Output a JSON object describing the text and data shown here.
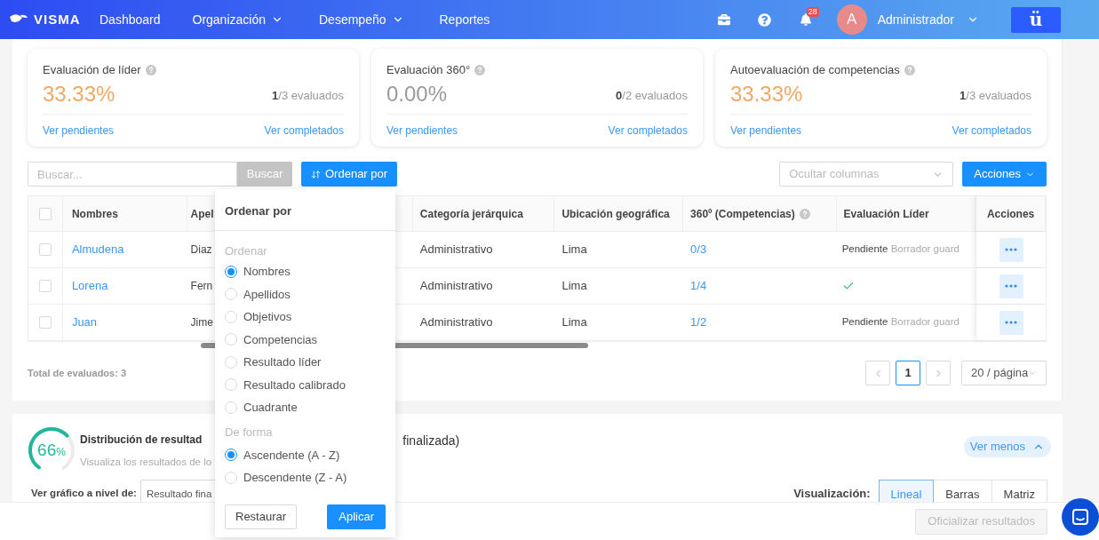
{
  "nav": {
    "logo": "VISMA",
    "items": [
      {
        "label": "Dashboard",
        "dropdown": false
      },
      {
        "label": "Organización",
        "dropdown": true
      },
      {
        "label": "Desempeño",
        "dropdown": true
      },
      {
        "label": "Reportes",
        "dropdown": false
      }
    ],
    "notifications": "28",
    "avatar": "A",
    "user": "Administrador",
    "app_button": "ü"
  },
  "cards": [
    {
      "title": "Evaluación de líder",
      "percent": "33.33%",
      "color": "#f2a863",
      "done": "1",
      "total": "/3 evaluados",
      "link_pending": "Ver pendientes",
      "link_done": "Ver completados"
    },
    {
      "title": "Evaluación 360°",
      "percent": "0.00%",
      "color": "#9b9b9b",
      "done": "0",
      "total": "/2 evaluados",
      "link_pending": "Ver pendientes",
      "link_done": "Ver completados"
    },
    {
      "title": "Autoevaluación de competencias",
      "percent": "33.33%",
      "color": "#f2a863",
      "done": "1",
      "total": "/3 evaluados",
      "link_pending": "Ver pendientes",
      "link_done": "Ver completados"
    }
  ],
  "toolbar": {
    "search": {
      "placeholder": "Buscar..."
    },
    "search_button": "Buscar",
    "sort_button": "Ordenar por",
    "hide_columns": {
      "placeholder": "Ocultar columnas"
    },
    "actions_button": "Acciones"
  },
  "table": {
    "select_all": {
      "checked": false
    },
    "columns": [
      {
        "label": "Nombres",
        "help": false
      },
      {
        "label": "Apel",
        "help": false
      },
      {
        "label": "Categoría jerárquica",
        "help": false
      },
      {
        "label": "Ubicación geográfica",
        "help": false
      },
      {
        "label": "360º (Competencias)",
        "help": true
      },
      {
        "label": "Evaluación Líder",
        "help": false
      },
      {
        "label": "Acciones",
        "help": false
      }
    ],
    "rows": [
      {
        "checked": false,
        "name": "Almudena",
        "surname": "Diaz",
        "category": "Administrativo",
        "location": "Lima",
        "competencias": "0/3",
        "leader": {
          "kind": "pending",
          "status": "Pendiente",
          "note": "Borrador guard"
        }
      },
      {
        "checked": false,
        "name": "Lorena",
        "surname": "Fern",
        "category": "Administrativo",
        "location": "Lima",
        "competencias": "1/4",
        "leader": {
          "kind": "done"
        }
      },
      {
        "checked": false,
        "name": "Juan",
        "surname": "Jime",
        "category": "Administrativo",
        "location": "Lima",
        "competencias": "1/2",
        "leader": {
          "kind": "pending",
          "status": "Pendiente",
          "note": "Borrador guard"
        }
      }
    ]
  },
  "total": "Total de evaluados: 3",
  "pagination": {
    "pages": [
      {
        "label": "1",
        "selected": true
      }
    ],
    "page_size": "20 / página"
  },
  "sort_popup": {
    "title": "Ordenar por",
    "groups": [
      {
        "label": "Ordenar",
        "options": [
          {
            "label": "Nombres",
            "selected": true
          },
          {
            "label": "Apellidos",
            "selected": false
          },
          {
            "label": "Objetivos",
            "selected": false
          },
          {
            "label": "Competencias",
            "selected": false
          },
          {
            "label": "Resultado líder",
            "selected": false
          },
          {
            "label": "Resultado calibrado",
            "selected": false
          },
          {
            "label": "Cuadrante",
            "selected": false
          }
        ]
      },
      {
        "label": "De forma",
        "options": [
          {
            "label": "Ascendente (A - Z)",
            "selected": true
          },
          {
            "label": "Descendente (Z - A)",
            "selected": false
          }
        ]
      }
    ],
    "reset_button": "Restaurar",
    "apply_button": "Aplicar"
  },
  "distribution": {
    "progress": {
      "value": "66",
      "unit": "%",
      "level": 0.66
    },
    "title": "Distribución de resultad",
    "title_end": "finalizada)",
    "subtitle": "Visualiza los resultados de lo",
    "toggle": "Ver menos",
    "level_label": "Ver gráfico a nivel de:",
    "level_value": "Resultado fina",
    "view_label": "Visualización:",
    "views": [
      {
        "label": "Lineal",
        "selected": true
      },
      {
        "label": "Barras",
        "selected": false
      },
      {
        "label": "Matriz",
        "selected": false
      }
    ]
  },
  "footer": {
    "button": "Oficializar resultados",
    "disabled": true
  }
}
